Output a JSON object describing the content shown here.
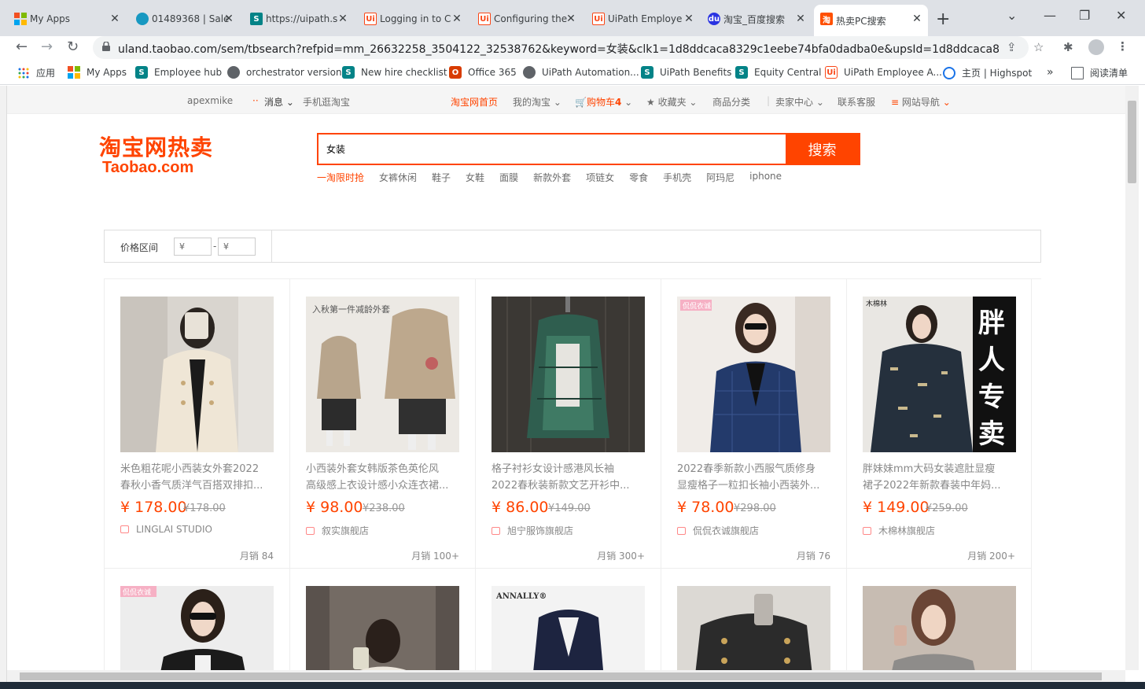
{
  "browser": {
    "tabs": [
      {
        "title": "My Apps",
        "favicon": "ms-grid-icon",
        "color": "#f25022"
      },
      {
        "title": "01489368 | Sale",
        "favicon": "salesforce-cloud-icon",
        "color": "#1798c1"
      },
      {
        "title": "https://uipath.s",
        "favicon": "sharepoint-icon",
        "color": "#038387"
      },
      {
        "title": "Logging in to C",
        "favicon": "uipath-icon",
        "color": "#fa4616"
      },
      {
        "title": "Configuring the",
        "favicon": "uipath-icon",
        "color": "#fa4616"
      },
      {
        "title": "UiPath Employe",
        "favicon": "uipath-icon",
        "color": "#fa4616"
      },
      {
        "title": "淘宝_百度搜索",
        "favicon": "baidu-paw-icon",
        "color": "#2932e1"
      },
      {
        "title": "热卖PC搜索",
        "favicon": "taobao-icon",
        "color": "#ff5000",
        "active": true
      }
    ],
    "url": "uland.taobao.com/sem/tbsearch?refpid=mm_26632258_3504122_32538762&keyword=女装&clk1=1d8ddcaca8329c1eebe74bfa0dadba0e&upsId=1d8ddcaca8329c1eebe74bfa0da..."
  },
  "bookmarks": [
    {
      "label": "应用",
      "icon": "apps-grid-icon"
    },
    {
      "label": "My Apps",
      "icon": "ms-grid-icon"
    },
    {
      "label": "Employee hub",
      "icon": "sharepoint-icon"
    },
    {
      "label": "orchestrator version",
      "icon": "globe-icon"
    },
    {
      "label": "New hire checklist",
      "icon": "sharepoint-icon"
    },
    {
      "label": "Office 365",
      "icon": "office-icon"
    },
    {
      "label": "UiPath Automation...",
      "icon": "globe-icon"
    },
    {
      "label": "UiPath Benefits",
      "icon": "sharepoint-icon"
    },
    {
      "label": "Equity Central",
      "icon": "sharepoint-icon"
    },
    {
      "label": "UiPath Employee A...",
      "icon": "uipath-icon"
    },
    {
      "label": "主页 | Highspot",
      "icon": "highspot-icon"
    }
  ],
  "bookmarks_more": "»",
  "reading_list": "阅读清单",
  "sitenav": {
    "user": "apexmike",
    "messages": "消息",
    "mobile": "手机逛淘宝",
    "home": "淘宝网首页",
    "my_taobao": "我的淘宝",
    "cart": "购物车",
    "cart_count": "4",
    "favorites": "收藏夹",
    "categories": "商品分类",
    "seller": "卖家中心",
    "service": "联系客服",
    "site_nav": "网站导航"
  },
  "logo": {
    "cn": "淘宝网",
    "cn2": "热卖",
    "en": "Taobao.com"
  },
  "search": {
    "value": "女装",
    "button": "搜索"
  },
  "hotwords": [
    "一淘限时抢",
    "女裤休闲",
    "鞋子",
    "女鞋",
    "面膜",
    "新款外套",
    "项链女",
    "零食",
    "手机壳",
    "阿玛尼",
    "iphone"
  ],
  "filter": {
    "label": "价格区间",
    "min_placeholder": "¥",
    "max_placeholder": "¥",
    "dash": "-"
  },
  "products": [
    {
      "title1": "米色粗花呢小西装女外套2022",
      "title2": "春秋小香气质洋气百搭双排扣...",
      "price": "¥ 178.00",
      "orig": "¥178.00",
      "shop": "LINGLAI STUDIO",
      "sales": "月销 84"
    },
    {
      "title1": "小西装外套女韩版茶色英伦风",
      "title2": "高级感上衣设计感小众连衣裙...",
      "price": "¥ 98.00",
      "orig": "¥238.00",
      "shop": "叙实旗舰店",
      "sales": "月销 100+"
    },
    {
      "title1": "格子衬衫女设计感港风长袖",
      "title2": "2022春秋装新款文艺开衫中...",
      "price": "¥ 86.00",
      "orig": "¥149.00",
      "shop": "旭宁服饰旗舰店",
      "sales": "月销 300+"
    },
    {
      "title1": "2022春季新款小西服气质修身",
      "title2": "显瘦格子一粒扣长袖小西装外...",
      "price": "¥ 78.00",
      "orig": "¥298.00",
      "shop": "侃侃衣诚旗舰店",
      "sales": "月销 76"
    },
    {
      "title1": "胖妹妹mm大码女装遮肚显瘦",
      "title2": "裙子2022年新款春装中年妈...",
      "price": "¥ 149.00",
      "orig": "¥259.00",
      "shop": "木棉林旗舰店",
      "sales": "月销 200+"
    }
  ],
  "image_overlays": {
    "p2": "入秋第一件减龄外套",
    "p4": "侃侃衣诚",
    "p5_brand": "木棉林",
    "p5_banner": "胖人专卖",
    "r2_1": "侃侃衣诚",
    "r2_3": "ANNALLY®"
  }
}
